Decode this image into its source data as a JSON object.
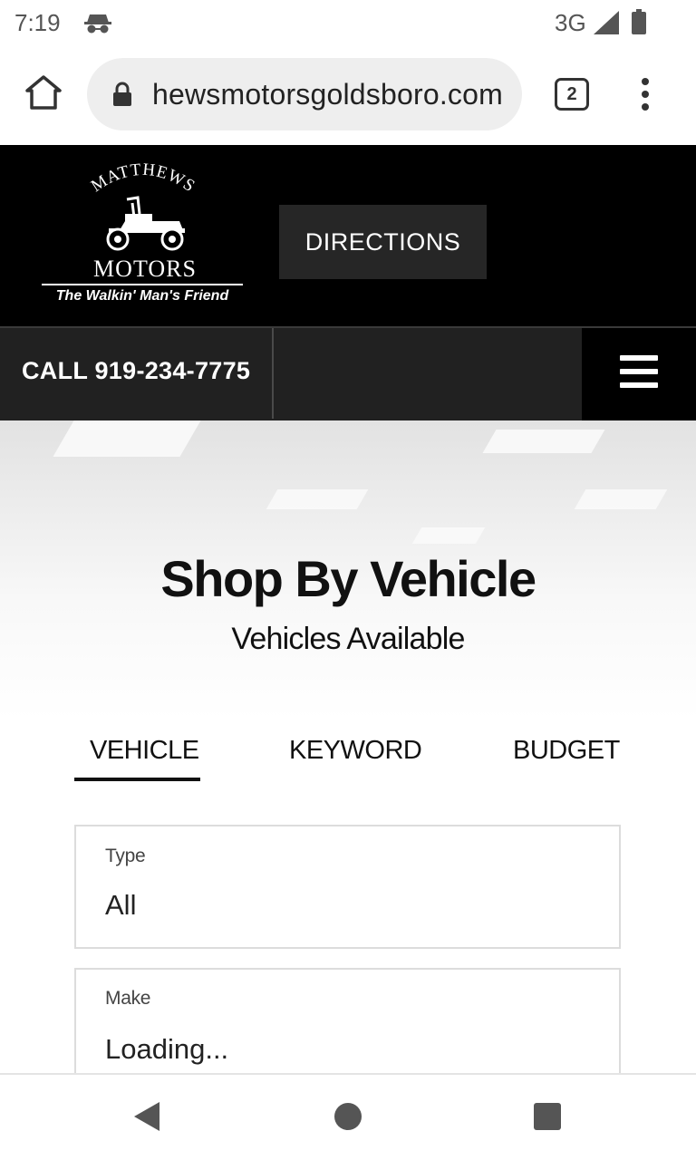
{
  "status": {
    "time": "7:19",
    "network": "3G",
    "carrier_icon": "incognito-icon",
    "signal_icon": "signal-icon",
    "battery_icon": "battery-icon"
  },
  "browser": {
    "url": "hewsmotorsgoldsboro.com",
    "tab_count": "2",
    "home_icon": "home-icon",
    "lock_icon": "lock-icon",
    "menu_icon": "more-vert-icon"
  },
  "header": {
    "logo_top_text": "MATTHEWS",
    "logo_motors": "MOTORS",
    "logo_tagline": "The Walkin' Man's Friend",
    "directions_label": "DIRECTIONS"
  },
  "callbar": {
    "call_label": "CALL 919-234-7775",
    "menu_icon": "hamburger-icon"
  },
  "hero": {
    "title": "Shop By Vehicle",
    "subtitle": "Vehicles Available"
  },
  "tabs": [
    {
      "label": "VEHICLE",
      "active": true
    },
    {
      "label": "KEYWORD",
      "active": false
    },
    {
      "label": "BUDGET",
      "active": false
    }
  ],
  "fields": [
    {
      "label": "Type",
      "value": "All"
    },
    {
      "label": "Make",
      "value": "Loading..."
    }
  ],
  "colors": {
    "header_bg": "#000000",
    "callbar_bg": "#212121",
    "button_bg": "#262626"
  },
  "navbar": {
    "back_icon": "back-icon",
    "home_icon": "home-circle-icon",
    "recent_icon": "recent-apps-icon"
  }
}
